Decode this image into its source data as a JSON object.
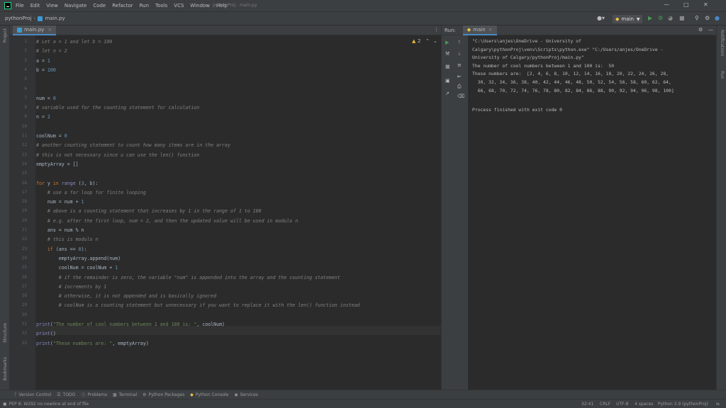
{
  "menubar": {
    "items": [
      "File",
      "Edit",
      "View",
      "Navigate",
      "Code",
      "Refactor",
      "Run",
      "Tools",
      "VCS",
      "Window",
      "Help"
    ],
    "window_title": "pythonProj - main.py"
  },
  "navbar": {
    "project": "pythonProj",
    "file": "main.py",
    "run_config": "main"
  },
  "editor": {
    "tab": "main.py",
    "warnings": "2",
    "lines": [
      {
        "n": "1",
        "t": "# Let a = 1 and let b = 100",
        "c": "cmt"
      },
      {
        "n": "2",
        "t": "# let n = 2",
        "c": "cmt"
      },
      {
        "n": "3",
        "t": "a = 1",
        "c": ""
      },
      {
        "n": "4",
        "t": "b = 100",
        "c": ""
      },
      {
        "n": "5",
        "t": "",
        "c": ""
      },
      {
        "n": "6",
        "t": "",
        "c": ""
      },
      {
        "n": "7",
        "t": "num = 0",
        "c": ""
      },
      {
        "n": "8",
        "t": "# variable used for the counting statement for calculation",
        "c": "cmt"
      },
      {
        "n": "9",
        "t": "n = 2",
        "c": ""
      },
      {
        "n": "10",
        "t": "",
        "c": ""
      },
      {
        "n": "11",
        "t": "coolNum = 0",
        "c": ""
      },
      {
        "n": "12",
        "t": "# another counting statement to count how many items are in the array",
        "c": "cmt"
      },
      {
        "n": "13",
        "t": "# this is not necessary since u can use the len() function",
        "c": "cmt"
      },
      {
        "n": "14",
        "t": "emptyArray = []",
        "c": ""
      },
      {
        "n": "15",
        "t": "",
        "c": ""
      },
      {
        "n": "16",
        "t": "for y in range (3, b):",
        "c": "kwl"
      },
      {
        "n": "17",
        "t": "    # use a for loop for finite looping",
        "c": "cmt"
      },
      {
        "n": "18",
        "t": "    num = num + 1",
        "c": ""
      },
      {
        "n": "19",
        "t": "    # above is a counting statement that increases by 1 in the range of 1 to 100",
        "c": "cmt"
      },
      {
        "n": "20",
        "t": "    # e.g. after the first loop, num = 2, and then the updated value will be used in modulo n",
        "c": "cmt"
      },
      {
        "n": "21",
        "t": "    ans = num % n",
        "c": ""
      },
      {
        "n": "22",
        "t": "    # this is modulo n",
        "c": "cmt"
      },
      {
        "n": "23",
        "t": "    if (ans == 0):",
        "c": "kwl"
      },
      {
        "n": "24",
        "t": "        emptyArray.append(num)",
        "c": ""
      },
      {
        "n": "25",
        "t": "        coolNum = coolNum + 1",
        "c": ""
      },
      {
        "n": "26",
        "t": "        # if the remainder is zero, the variable \"num\" is appended into the array and the counting statement",
        "c": "cmt"
      },
      {
        "n": "27",
        "t": "        # increments by 1",
        "c": "cmt"
      },
      {
        "n": "28",
        "t": "        # otherwise, it is not appended and is basically ignored",
        "c": "cmt"
      },
      {
        "n": "29",
        "t": "        # coolNum is a counting statement but unnecessary if you want to replace it with the len() function instead",
        "c": "cmt"
      },
      {
        "n": "30",
        "t": "",
        "c": ""
      },
      {
        "n": "31",
        "t": "print(\"The number of cool numbers between 1 and 100 is: \", coolNum)",
        "c": "prt"
      },
      {
        "n": "32",
        "t": "print()",
        "c": "prt"
      },
      {
        "n": "33",
        "t": "print(\"These numbers are: \", emptyArray)",
        "c": "prt"
      }
    ]
  },
  "run": {
    "label": "Run:",
    "tab": "main",
    "output": [
      "\"C:\\Users\\anjes\\OneDrive - University of",
      "Calgary\\pythonProj\\venv\\Scripts\\python.exe\" \"C:/Users/anjes/OneDrive -",
      "University of Calgary/pythonProj/main.py\"",
      "The number of cool numbers between 1 and 100 is:  50",
      "These numbers are:  [2, 4, 6, 8, 10, 12, 14, 16, 18, 20, 22, 24, 26, 28,",
      "  30, 32, 34, 36, 38, 40, 42, 44, 46, 48, 50, 52, 54, 56, 58, 60, 62, 64,",
      "  66, 68, 70, 72, 74, 76, 78, 80, 82, 84, 86, 88, 90, 92, 94, 96, 98, 100]",
      "",
      "Process finished with exit code 0"
    ]
  },
  "stripes": {
    "left": [
      "Project",
      "Structure",
      "Bookmarks"
    ],
    "right": [
      "Notifications",
      "Run"
    ]
  },
  "tooltabs": [
    "Version Control",
    "TODO",
    "Problems",
    "Terminal",
    "Python Packages",
    "Python Console",
    "Services"
  ],
  "status": {
    "message": "PEP 8: W292 no newline at end of file",
    "position": "32:41",
    "line_sep": "CRLF",
    "encoding": "UTF-8",
    "indent": "4 spaces",
    "interpreter": "Python 3.9 (pythonProj)"
  },
  "colors": {
    "background": "#2b2b2b",
    "panel": "#3c3f41",
    "comment": "#808080",
    "keyword": "#cc7832",
    "string": "#6a8759",
    "number": "#6897bb",
    "run_green": "#499c54"
  }
}
